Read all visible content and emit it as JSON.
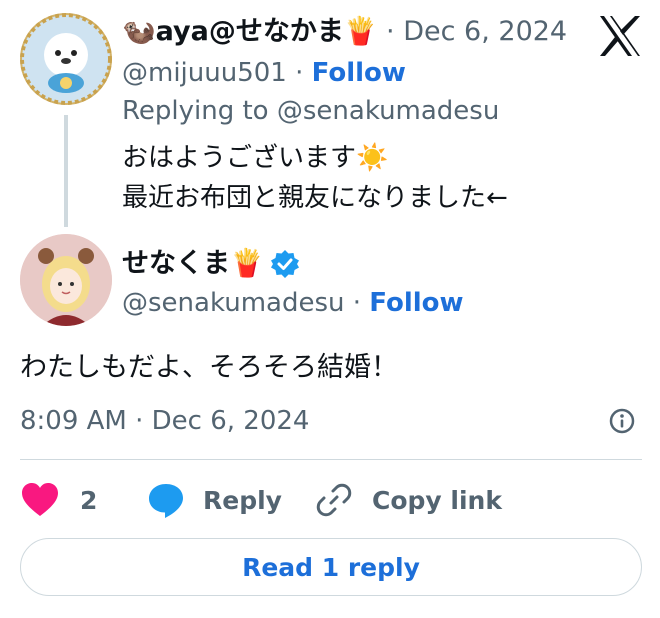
{
  "parent": {
    "display_name": "🦦aya@せなかま🍟",
    "date": "Dec 6, 2024",
    "handle": "@mijuuu501",
    "follow": "Follow",
    "replying_prefix": "Replying to",
    "replying_to": "@senakumadesu",
    "text_line1": "おはようございます☀️",
    "text_line2": "最近お布団と親友になりました←"
  },
  "main": {
    "display_name": "せなくま🍟",
    "handle": "@senakumadesu",
    "follow": "Follow",
    "text": "わたしもだよ、そろそろ結婚！",
    "timestamp": "8:09 AM · Dec 6, 2024"
  },
  "actions": {
    "like_count": "2",
    "reply_label": "Reply",
    "copy_link_label": "Copy link"
  },
  "read_replies_label": "Read 1 reply",
  "colors": {
    "link": "#1d6fd9",
    "muted": "#536471",
    "like": "#f91880",
    "verified": "#1d9bf0",
    "divider": "#cfd9de"
  },
  "icons": {
    "brand": "x-logo-icon",
    "verified": "verified-badge-icon",
    "info": "info-icon",
    "like": "heart-icon",
    "reply": "reply-bubble-icon",
    "copy": "link-chain-icon"
  }
}
